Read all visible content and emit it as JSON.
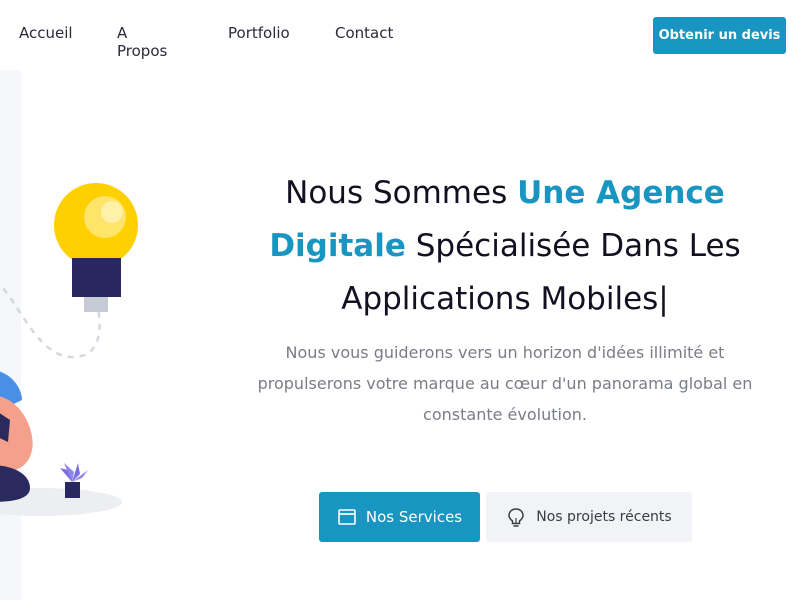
{
  "nav": {
    "links": [
      "Accueil",
      "A Propos",
      "Portfolio",
      "Contact"
    ],
    "cta_label": "Obtenir un devis"
  },
  "hero": {
    "headline": {
      "part1": "Nous Sommes ",
      "accent": "Une Agence Digitale",
      "part2": " Spécialisée Dans Les Applications Mobiles",
      "cursor": "|"
    },
    "subtitle": "Nous vous guiderons vers un horizon d'idées illimité et propulserons votre marque au cœur d'un panorama global en constante évolution.",
    "primary_button": {
      "label": "Nos Services",
      "icon": "folder-icon"
    },
    "secondary_button": {
      "label": "Nos projets récents",
      "icon": "lightbulb-icon"
    }
  },
  "colors": {
    "accent": "#1895c0",
    "text_dark": "#111122",
    "text_muted": "#7a7d86",
    "bulb_yellow": "#ffd000",
    "bulb_base": "#28285e",
    "plant_purple": "#7a6ee0"
  }
}
